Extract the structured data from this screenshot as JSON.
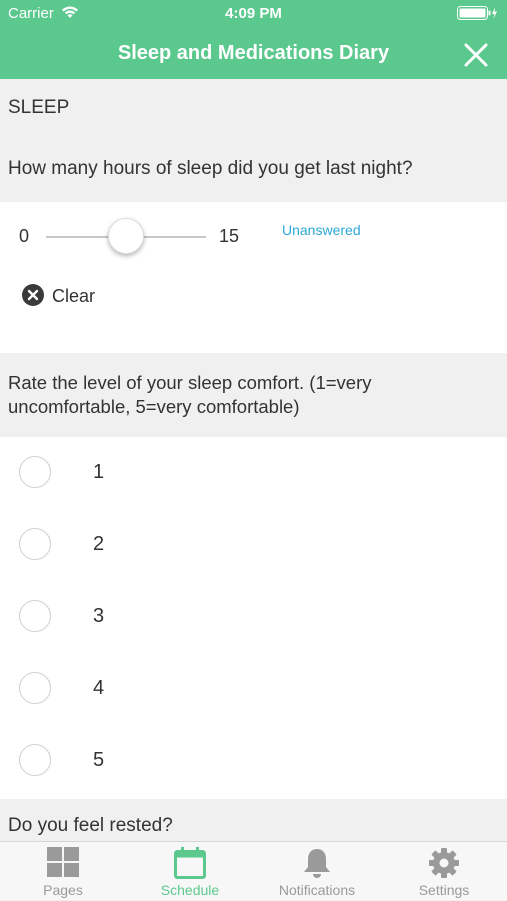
{
  "status_bar": {
    "carrier": "Carrier",
    "time": "4:09 PM"
  },
  "header": {
    "title": "Sleep and Medications Diary"
  },
  "section": {
    "title": "SLEEP"
  },
  "question_hours": {
    "text": "How many hours of sleep did you get last night?",
    "slider_min": "0",
    "slider_max": "15",
    "slider_fraction": 0.5,
    "status": "Unanswered",
    "clear_label": "Clear"
  },
  "question_comfort": {
    "text": "Rate the level of your sleep comfort. (1=very uncomfortable, 5=very comfortable)",
    "options": [
      "1",
      "2",
      "3",
      "4",
      "5"
    ]
  },
  "question_rested": {
    "text": "Do you feel rested?"
  },
  "tabs": [
    {
      "label": "Pages",
      "icon": "grid-icon",
      "active": false
    },
    {
      "label": "Schedule",
      "icon": "calendar-icon",
      "active": true
    },
    {
      "label": "Notifications",
      "icon": "bell-icon",
      "active": false
    },
    {
      "label": "Settings",
      "icon": "gear-icon",
      "active": false
    }
  ],
  "colors": {
    "accent": "#5bc98e",
    "link": "#2ea8d8",
    "inactive_tab": "#9a9a9a"
  }
}
